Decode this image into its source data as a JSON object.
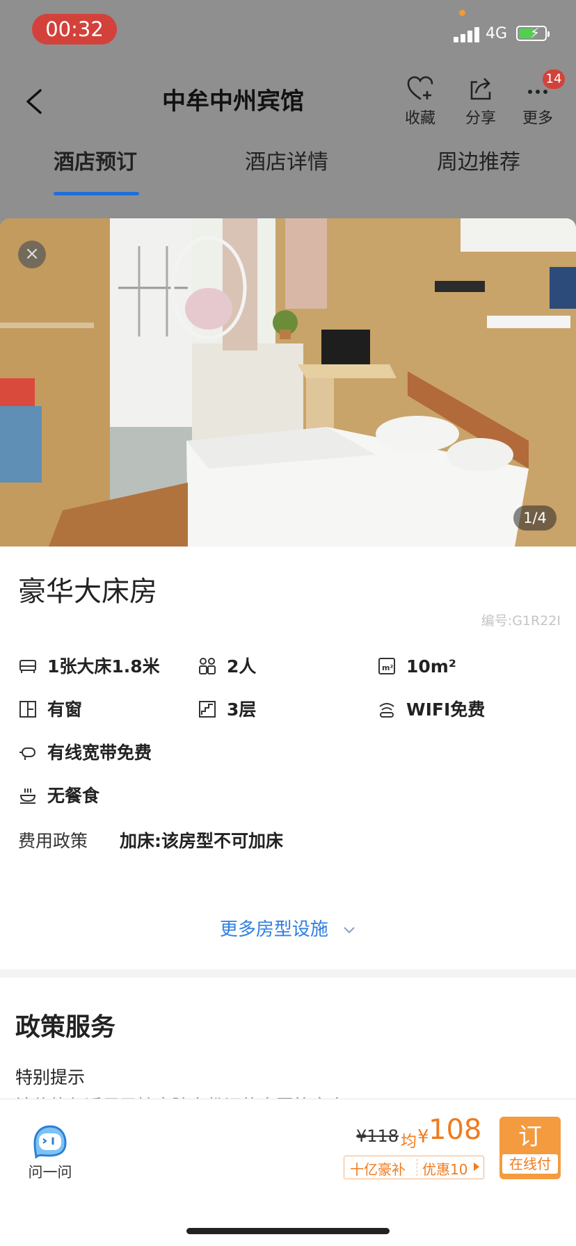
{
  "status_bar": {
    "time": "00:32",
    "network": "4G",
    "colors": {
      "time_pill": "#d2423a",
      "battery_fill": "#51d04f"
    }
  },
  "header": {
    "title": "中牟中州宾馆",
    "actions": [
      {
        "label": "收藏",
        "icon": "heart-plus-icon"
      },
      {
        "label": "分享",
        "icon": "share-icon"
      },
      {
        "label": "更多",
        "icon": "more-icon",
        "badge": "14"
      }
    ]
  },
  "tabs": [
    {
      "label": "酒店预订",
      "active": true
    },
    {
      "label": "酒店详情",
      "active": false
    },
    {
      "label": "周边推荐",
      "active": false
    }
  ],
  "photo": {
    "counter": "1/4"
  },
  "room": {
    "name": "豪华大床房",
    "code": "编号:G1R22I",
    "facilities": {
      "bed": "1张大床1.8米",
      "guests": "2人",
      "area": "10m²",
      "window": "有窗",
      "floor": "3层",
      "wifi": "WIFI免费",
      "broadband": "有线宽带免费",
      "meal": "无餐食"
    },
    "fee_policy_label": "费用政策",
    "fee_policy_value": "加床:该房型不可加床",
    "more_link": "更多房型设施"
  },
  "policy": {
    "title": "政策服务",
    "special_label": "特别提示",
    "partial_text": "该价格仅适用于持大陆身份证的中国籍客人"
  },
  "bottom_bar": {
    "ask_label": "问一问",
    "original_price": "¥118",
    "avg_label": "均",
    "currency": "¥",
    "price": "108",
    "promo_left": "十亿豪补",
    "promo_right": "优惠10",
    "book_main": "订",
    "book_sub": "在线付",
    "accent_color": "#f07b1e"
  }
}
